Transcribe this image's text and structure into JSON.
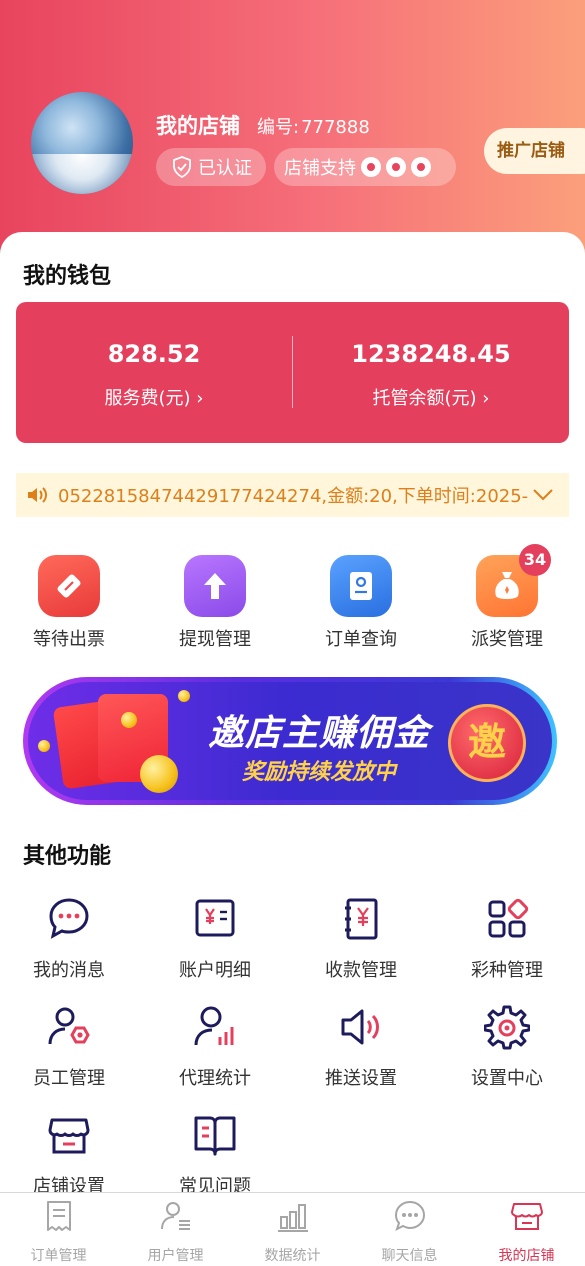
{
  "header": {
    "shop_name": "我的店铺",
    "shop_number_label": "编号:",
    "shop_number": "777888",
    "verified_label": "已认证",
    "support_label": "店铺支持",
    "promote_button": "推广店铺"
  },
  "wallet": {
    "title": "我的钱包",
    "service_fee_value": "828.52",
    "service_fee_label": "服务费(元)",
    "escrow_value": "1238248.45",
    "escrow_label": "托管余额(元)"
  },
  "notice": {
    "text": "05228158474429177424274,金额:20,下单时间:2025-"
  },
  "quick_actions": [
    {
      "label": "等待出票",
      "icon": "ticket-icon",
      "color": "#f24b4b"
    },
    {
      "label": "提现管理",
      "icon": "withdraw-arrow-icon",
      "color": "#a05cf0"
    },
    {
      "label": "订单查询",
      "icon": "order-search-icon",
      "color": "#3a86ee"
    },
    {
      "label": "派奖管理",
      "icon": "prize-bag-icon",
      "color": "#ff8a3c",
      "badge": "34"
    }
  ],
  "banner": {
    "title": "邀店主赚佣金",
    "subtitle": "奖励持续发放中",
    "circle_text": "邀"
  },
  "other_functions": {
    "title": "其他功能",
    "items": [
      {
        "label": "我的消息",
        "icon": "message-icon"
      },
      {
        "label": "账户明细",
        "icon": "account-detail-icon"
      },
      {
        "label": "收款管理",
        "icon": "payment-book-icon"
      },
      {
        "label": "彩种管理",
        "icon": "category-grid-icon"
      },
      {
        "label": "员工管理",
        "icon": "staff-icon"
      },
      {
        "label": "代理统计",
        "icon": "agent-stats-icon"
      },
      {
        "label": "推送设置",
        "icon": "speaker-icon"
      },
      {
        "label": "设置中心",
        "icon": "gear-icon"
      },
      {
        "label": "店铺设置",
        "icon": "store-icon"
      },
      {
        "label": "常见问题",
        "icon": "faq-book-icon"
      }
    ]
  },
  "tabbar": [
    {
      "label": "订单管理",
      "icon": "receipt-icon",
      "active": false
    },
    {
      "label": "用户管理",
      "icon": "user-list-icon",
      "active": false
    },
    {
      "label": "数据统计",
      "icon": "bar-chart-icon",
      "active": false
    },
    {
      "label": "聊天信息",
      "icon": "chat-bubble-icon",
      "active": false
    },
    {
      "label": "我的店铺",
      "icon": "store-icon",
      "active": true
    }
  ],
  "colors": {
    "accent": "#e43f5c",
    "icon_navy": "#1d1b5c",
    "notice_text": "#dd7f1a",
    "notice_bg": "#fff6dc"
  }
}
